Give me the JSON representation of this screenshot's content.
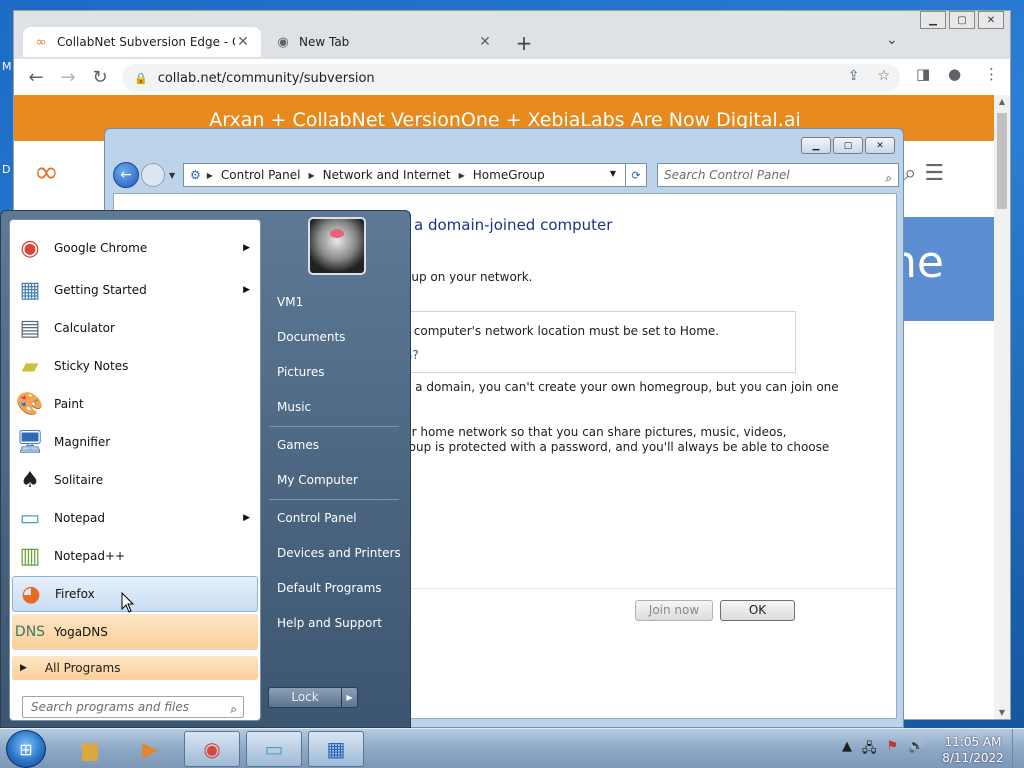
{
  "desktop": {
    "icon_labels": [
      "M",
      "D"
    ]
  },
  "browser": {
    "tabs": [
      {
        "title": "CollabNet Subversion Edge - Co",
        "active": true
      },
      {
        "title": "New Tab",
        "active": false
      }
    ],
    "url": "collab.net/community/subversion",
    "page": {
      "banner_text": "Arxan + CollabNet VersionOne + XebiaLabs Are Now Digital.ai",
      "hero_fragment": "ne"
    }
  },
  "control_panel": {
    "breadcrumbs": [
      "Control Panel",
      "Network and Internet",
      "HomeGroup"
    ],
    "search_placeholder": "Search Control Panel",
    "heading_fragment": "a domain-joined computer",
    "line1": "oup on your network.",
    "box_line": "r computer's network location must be set to Home.",
    "box_link_fragment": "a?",
    "line2a": "o a domain, you can't create your own homegroup, but you can join one",
    "line2b": ".",
    "line3a": "ur home network so that you can share pictures, music, videos,",
    "line3b": "roup is protected with a password, and you'll always be able to choose",
    "join_now_label": "Join now",
    "ok_label": "OK"
  },
  "start_menu": {
    "programs": [
      {
        "label": "Google Chrome",
        "icon": "chrome-icon",
        "submenu": true
      },
      {
        "label": "Getting Started",
        "icon": "getting-started-icon",
        "submenu": true
      },
      {
        "label": "Calculator",
        "icon": "calculator-icon",
        "submenu": false
      },
      {
        "label": "Sticky Notes",
        "icon": "sticky-notes-icon",
        "submenu": false
      },
      {
        "label": "Paint",
        "icon": "paint-icon",
        "submenu": false
      },
      {
        "label": "Magnifier",
        "icon": "magnifier-icon",
        "submenu": false
      },
      {
        "label": "Solitaire",
        "icon": "solitaire-icon",
        "submenu": false
      },
      {
        "label": "Notepad",
        "icon": "notepad-icon",
        "submenu": true
      },
      {
        "label": "Notepad++",
        "icon": "notepad-plus-plus-icon",
        "submenu": false
      },
      {
        "label": "Firefox",
        "icon": "firefox-icon",
        "submenu": false,
        "hovered": true
      },
      {
        "label": "YogaDNS",
        "icon": "yogadns-icon",
        "submenu": false,
        "newly_installed": true
      }
    ],
    "all_programs_label": "All Programs",
    "search_placeholder": "Search programs and files",
    "right_items": [
      {
        "label": "VM1"
      },
      {
        "label": "Documents"
      },
      {
        "label": "Pictures"
      },
      {
        "label": "Music"
      },
      {
        "label": "Games"
      },
      {
        "label": "My Computer"
      },
      {
        "label": "Control Panel"
      },
      {
        "label": "Devices and Printers"
      },
      {
        "label": "Default Programs"
      },
      {
        "label": "Help and Support"
      }
    ],
    "lock_label": "Lock"
  },
  "taskbar": {
    "pinned": [
      "explorer-icon",
      "media-player-icon",
      "chrome-icon",
      "notepad-icon",
      "control-panel-icon"
    ],
    "clock_time": "11:05 AM",
    "clock_date": "8/11/2022"
  },
  "colors": {
    "banner": "#e8891e",
    "start_menu": "#4a6785",
    "link": "#0066cc",
    "heading": "#1e3287"
  }
}
